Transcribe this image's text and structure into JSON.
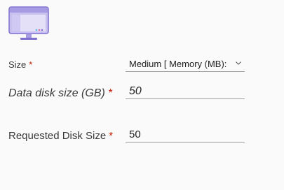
{
  "icon": {
    "name": "virtual-machine-icon",
    "accent": "#8b7ad6"
  },
  "fields": {
    "size": {
      "label": "Size",
      "required_mark": "*",
      "value": "Medium [ Memory (MB):"
    },
    "data_disk": {
      "label": "Data disk size (GB)",
      "required_mark": "*",
      "value": "50"
    },
    "requested_disk": {
      "label": "Requested Disk Size",
      "required_mark": "*",
      "value": "50"
    }
  }
}
